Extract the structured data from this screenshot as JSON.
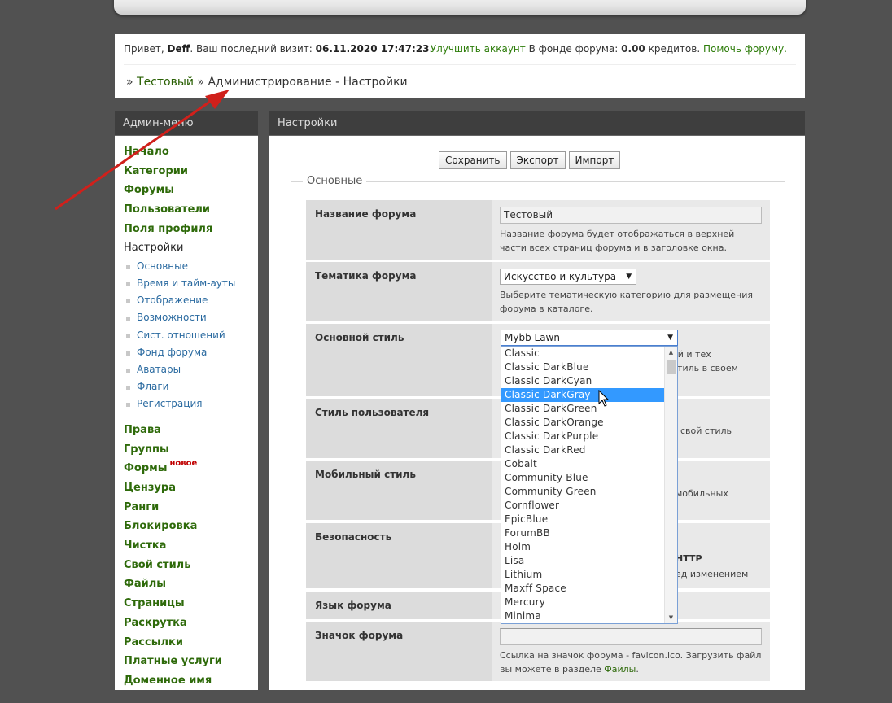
{
  "welcome": {
    "greeting": "Привет, ",
    "username": "Deff",
    "last_visit_label": ". Ваш последний визит: ",
    "last_visit_value": "06.11.2020 17:47:23",
    "upgrade_link": "Улучшить аккаунт",
    "fund_label": " В фонде форума: ",
    "fund_value": "0.00",
    "fund_unit": " кредитов. ",
    "help_link": "Помочь форуму."
  },
  "breadcrumb": {
    "sep1": "» ",
    "forum_link": "Тестовый",
    "sep2": " » ",
    "rest": "Администрирование - Настройки"
  },
  "admin_menu": {
    "title": "Админ-меню",
    "items_top": [
      "Начало",
      "Категории",
      "Форумы",
      "Пользователи",
      "Поля профиля"
    ],
    "active_item": "Настройки",
    "sub_items": [
      "Основные",
      "Время и тайм-ауты",
      "Отображение",
      "Возможности",
      "Сист. отношений",
      "Фонд форума",
      "Аватары",
      "Флаги",
      "Регистрация"
    ],
    "items_bottom": [
      "Права",
      "Группы",
      "Формы",
      "Цензура",
      "Ранги",
      "Блокировка",
      "Чистка",
      "Свой стиль",
      "Файлы",
      "Страницы",
      "Раскрутка",
      "Рассылки",
      "Платные услуги",
      "Доменное имя"
    ],
    "new_badge": "новое"
  },
  "settings": {
    "title": "Настройки",
    "save_label": "Сохранить",
    "export_label": "Экспорт",
    "import_label": "Импорт",
    "section_legend": "Основные",
    "forum_name_label": "Название форума",
    "forum_name_value": "Тестовый",
    "forum_name_desc": "Название форума будет отображаться в верхней части всех страниц форума и в заголовке окна.",
    "theme_label": "Тематика форума",
    "theme_value": "Искусство и культура",
    "theme_desc": "Выберите тематическую категорию для размещения форума в каталоге.",
    "main_style_label": "Основной стиль",
    "main_style_value": "Mybb Lawn",
    "main_style_desc_part1": "ей и тех",
    "main_style_desc_part2": "стиль в своем",
    "user_style_label": "Стиль пользователя",
    "user_style_desc_part": "свой стиль",
    "mobile_style_label": "Мобильный стиль",
    "mobile_style_desc_part": "мобильных",
    "security_label": "Безопасность",
    "security_desc_part1": "HTTP",
    "security_desc_part2": "ед изменением",
    "language_label": "Язык форума",
    "icon_label": "Значок форума",
    "icon_value": "",
    "icon_desc": "Ссылка на значок форума - favicon.ico. Загрузить файл вы можете в разделе ",
    "icon_desc_link": "Файлы",
    "icon_desc_end": "."
  },
  "style_options": [
    "Classic",
    "Classic DarkBlue",
    "Classic DarkCyan",
    "Classic DarkGray",
    "Classic DarkGreen",
    "Classic DarkOrange",
    "Classic DarkPurple",
    "Classic DarkRed",
    "Cobalt",
    "Community Blue",
    "Community Green",
    "Cornflower",
    "EpicBlue",
    "ForumBB",
    "Holm",
    "Lisa",
    "Lithium",
    "Maxff Space",
    "Mercury",
    "Minima"
  ],
  "highlighted_option": "Classic DarkGray",
  "colors": {
    "link_green": "#2e6a0a",
    "highlight": "#3399ff",
    "arrow_red": "#d0201b"
  }
}
